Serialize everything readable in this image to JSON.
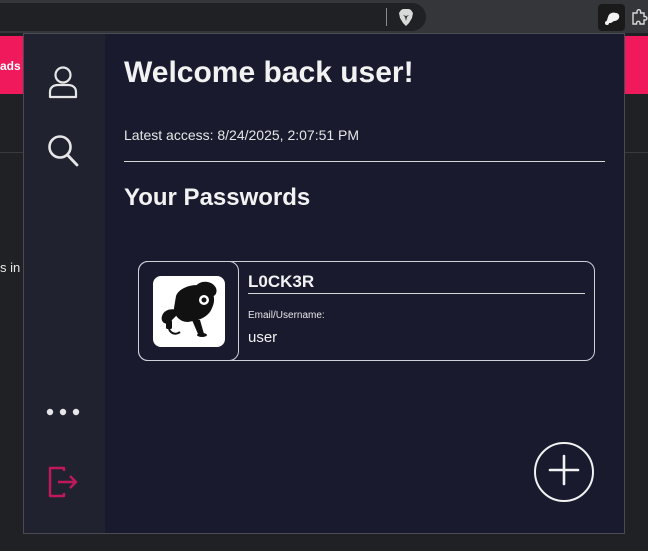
{
  "background_page": {
    "banner_text": "ads",
    "side_text": "s in",
    "banner_color": "#f0195c"
  },
  "browser": {
    "brave_icon": "brave-lion-icon",
    "extension_icon": "locker-extension-icon",
    "extensions_icon": "puzzle-icon"
  },
  "sidebar": {
    "items": [
      {
        "name": "profile",
        "icon": "user-icon"
      },
      {
        "name": "search",
        "icon": "search-icon"
      },
      {
        "name": "more",
        "icon": "more-dots-icon"
      },
      {
        "name": "logout",
        "icon": "logout-icon",
        "color": "#c0185a"
      }
    ]
  },
  "main": {
    "welcome": "Welcome back user!",
    "latest_access": "Latest access: 8/24/2025, 2:07:51 PM",
    "section_title": "Your Passwords"
  },
  "passwords": [
    {
      "name": "L0CK3R",
      "field_label": "Email/Username:",
      "field_value": "user",
      "logo_icon": "detective-dog-logo-icon"
    }
  ],
  "actions": {
    "add_icon": "plus-icon"
  },
  "colors": {
    "popup_bg": "#191a2e",
    "sidebar_bg": "#21222f",
    "text": "#f2f2f2",
    "accent": "#c0185a"
  }
}
